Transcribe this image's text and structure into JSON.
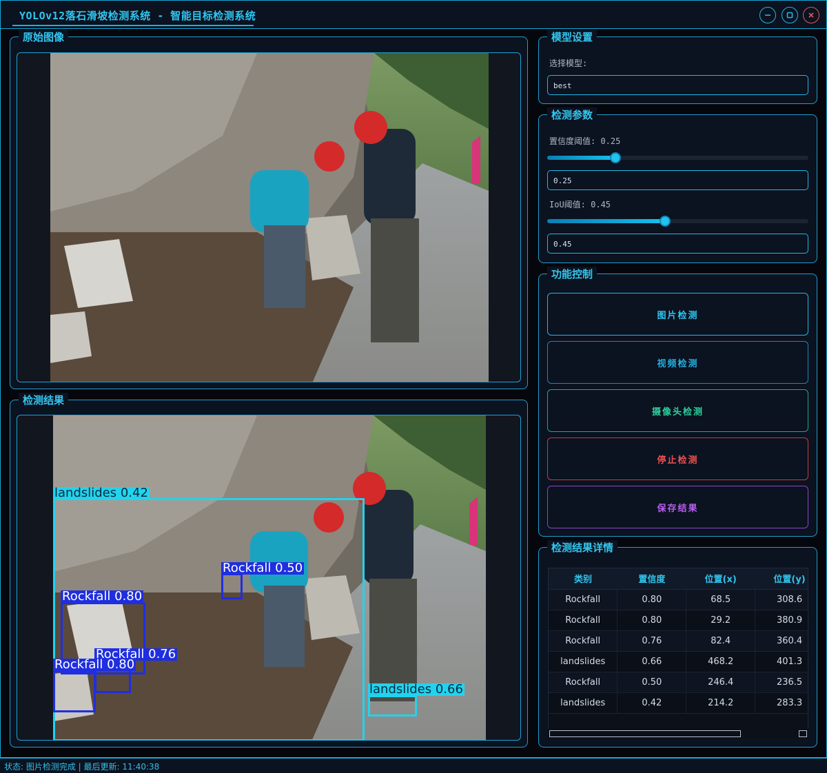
{
  "window": {
    "title": "YOLOv12落石滑坡检测系统 - 智能目标检测系统"
  },
  "panels": {
    "original": {
      "title": "原始图像"
    },
    "result": {
      "title": "检测结果"
    }
  },
  "model_settings": {
    "title": "模型设置",
    "select_label": "选择模型:",
    "selected_model": "best"
  },
  "params": {
    "title": "检测参数",
    "confidence_label": "置信度阈值: 0.25",
    "confidence_value": "0.25",
    "confidence_fraction": 0.25,
    "iou_label": "IoU阈值: 0.45",
    "iou_value": "0.45",
    "iou_fraction": 0.45
  },
  "controls": {
    "title": "功能控制",
    "image_detect": "图片检测",
    "video_detect": "视频检测",
    "camera_detect": "摄像头检测",
    "stop_detect": "停止检测",
    "save_result": "保存结果"
  },
  "details": {
    "title": "检测结果详情",
    "columns": [
      "类别",
      "置信度",
      "位置(x)",
      "位置(y)"
    ],
    "rows": [
      [
        "Rockfall",
        "0.80",
        "68.5",
        "308.6"
      ],
      [
        "Rockfall",
        "0.80",
        "29.2",
        "380.9"
      ],
      [
        "Rockfall",
        "0.76",
        "82.4",
        "360.4"
      ],
      [
        "landslides",
        "0.66",
        "468.2",
        "401.3"
      ],
      [
        "Rockfall",
        "0.50",
        "246.4",
        "236.5"
      ],
      [
        "landslides",
        "0.42",
        "214.2",
        "283.3"
      ]
    ]
  },
  "detections": [
    {
      "label": "landslides 0.42"
    },
    {
      "label": "Rockfall 0.50"
    },
    {
      "label": "Rockfall 0.80"
    },
    {
      "label": "Rockfall 0.76"
    },
    {
      "label": "Rockfall 0.80"
    },
    {
      "label": "landslides 0.66"
    }
  ],
  "status": {
    "text": "状态: 图片检测完成 | 最后更新: 11:40:38"
  },
  "colors": {
    "accent": "#22b8e6",
    "image_detect": "#22b8e6",
    "video_detect": "#1ea8d6",
    "camera_detect": "#2ecf9a",
    "stop_detect": "#e04a4a",
    "save_result": "#b05ae6",
    "landslides_box": "#22d3ee",
    "rockfall_box": "#1f2ee0"
  },
  "icons": {
    "minimize": "minimize-icon",
    "maximize": "maximize-icon",
    "close": "close-icon"
  }
}
